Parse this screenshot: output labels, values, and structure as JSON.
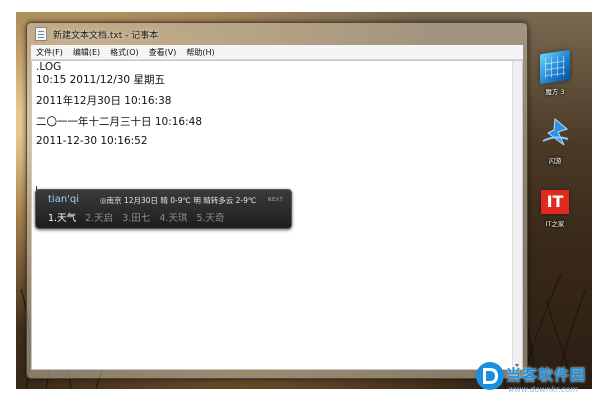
{
  "window": {
    "title": "新建文本文档.txt - 记事本"
  },
  "menu": [
    {
      "label": "文件(F)"
    },
    {
      "label": "编辑(E)"
    },
    {
      "label": "格式(O)"
    },
    {
      "label": "查看(V)"
    },
    {
      "label": "帮助(H)"
    }
  ],
  "editor": {
    "lines": [
      ".LOG",
      "10:15 2011/12/30 星期五",
      "2011年12月30日 10:16:38",
      "二〇一一年十二月三十日 10:16:48",
      "2011-12-30 10:16:52"
    ]
  },
  "ime": {
    "pinyin": "tian'qi",
    "weather": "◎南京 12月30日 晴 0-9℃ 明 晴转多云 2-9℃",
    "candidates": [
      "1.天气",
      "2.天启",
      "3.田七",
      "4.天琪",
      "5.天奇"
    ],
    "active_candidate": 0,
    "logo_tag": "NEXT"
  },
  "desktop_icons": [
    {
      "label": "魔方 3",
      "icon": "magic-cube-icon"
    },
    {
      "label": "闪游",
      "icon": "flash-browser-icon"
    },
    {
      "label": "IT之家",
      "icon": "it-home-icon",
      "glyph": "IT"
    }
  ],
  "watermark": {
    "text": "当客软件园",
    "url": "www.downkr.com"
  },
  "colors": {
    "it_home_red": "#e02a1f",
    "watermark_blue": "#1a8fe0"
  }
}
